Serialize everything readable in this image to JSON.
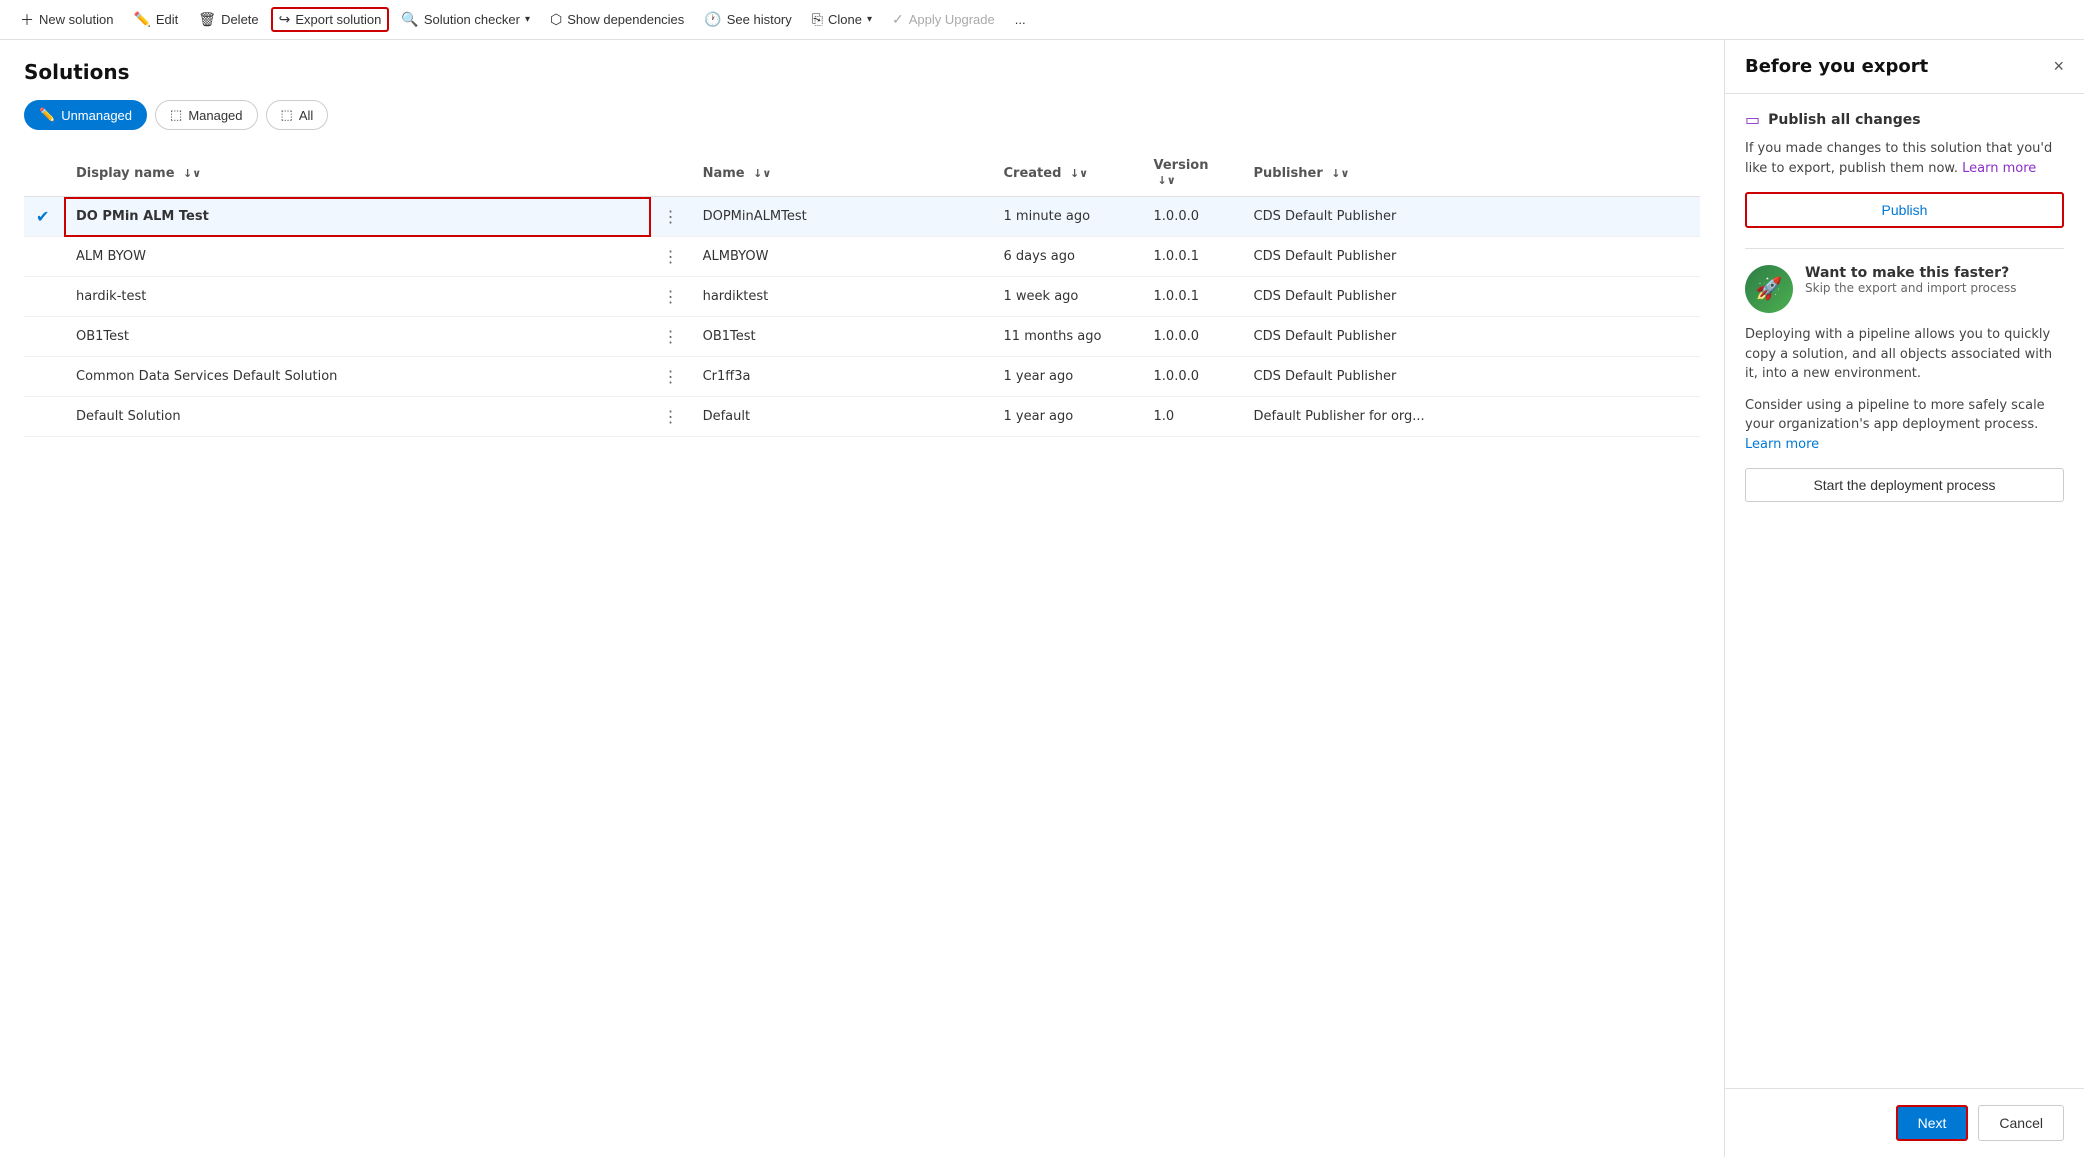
{
  "toolbar": {
    "new_solution": "New solution",
    "edit": "Edit",
    "delete": "Delete",
    "export_solution": "Export solution",
    "solution_checker": "Solution checker",
    "show_dependencies": "Show dependencies",
    "see_history": "See history",
    "clone": "Clone",
    "apply_upgrade": "Apply Upgrade",
    "more": "..."
  },
  "solutions": {
    "title": "Solutions",
    "filters": [
      {
        "label": "Unmanaged",
        "active": true
      },
      {
        "label": "Managed",
        "active": false
      },
      {
        "label": "All",
        "active": false
      }
    ],
    "columns": [
      {
        "label": "Display name",
        "sort": "↓"
      },
      {
        "label": "Name",
        "sort": "↓"
      },
      {
        "label": "Created",
        "sort": "↓"
      },
      {
        "label": "Version",
        "sort": "↓"
      },
      {
        "label": "Publisher",
        "sort": "↓"
      }
    ],
    "rows": [
      {
        "selected": true,
        "display_name": "DO PMin ALM Test",
        "name": "DOPMinALMTest",
        "created": "1 minute ago",
        "version": "1.0.0.0",
        "publisher": "CDS Default Publisher"
      },
      {
        "selected": false,
        "display_name": "ALM BYOW",
        "name": "ALMBYOW",
        "created": "6 days ago",
        "version": "1.0.0.1",
        "publisher": "CDS Default Publisher"
      },
      {
        "selected": false,
        "display_name": "hardik-test",
        "name": "hardiktest",
        "created": "1 week ago",
        "version": "1.0.0.1",
        "publisher": "CDS Default Publisher"
      },
      {
        "selected": false,
        "display_name": "OB1Test",
        "name": "OB1Test",
        "created": "11 months ago",
        "version": "1.0.0.0",
        "publisher": "CDS Default Publisher"
      },
      {
        "selected": false,
        "display_name": "Common Data Services Default Solution",
        "name": "Cr1ff3a",
        "created": "1 year ago",
        "version": "1.0.0.0",
        "publisher": "CDS Default Publisher"
      },
      {
        "selected": false,
        "display_name": "Default Solution",
        "name": "Default",
        "created": "1 year ago",
        "version": "1.0",
        "publisher": "Default Publisher for org..."
      }
    ]
  },
  "panel": {
    "title": "Before you export",
    "close_label": "×",
    "section1": {
      "icon": "📋",
      "title": "Publish all changes",
      "description": "If you made changes to this solution that you'd like to export, publish them now.",
      "learn_more": "Learn more",
      "publish_btn": "Publish"
    },
    "section2": {
      "header_bold": "Want to make this faster?",
      "header_sub": "Skip the export and import process",
      "desc1": "Deploying with a pipeline allows you to quickly copy a solution, and all objects associated with it, into a new environment.",
      "desc2": "Consider using a pipeline to more safely scale your organization's app deployment process.",
      "learn_more": "Learn more",
      "deploy_btn": "Start the deployment process"
    },
    "footer": {
      "next_btn": "Next",
      "cancel_btn": "Cancel"
    }
  }
}
